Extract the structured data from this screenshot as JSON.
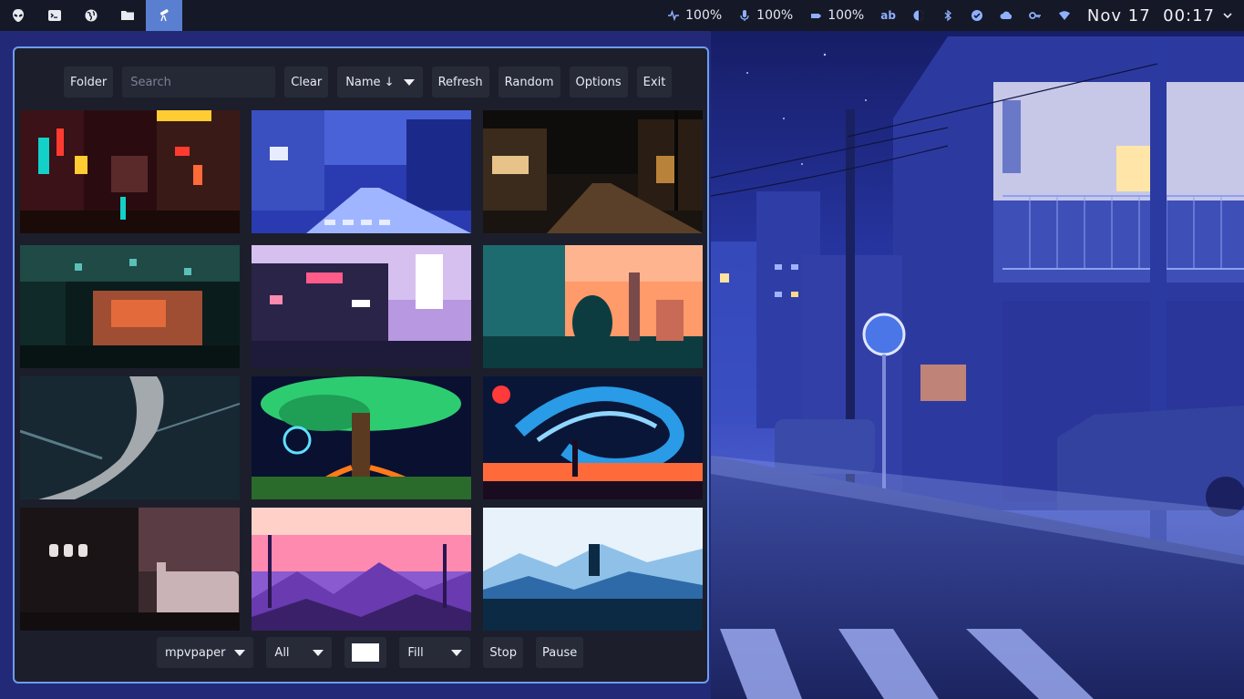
{
  "topbar": {
    "workspaces": [
      {
        "icon": "alien-icon",
        "active": false
      },
      {
        "icon": "terminal-icon",
        "active": false
      },
      {
        "icon": "globe-icon",
        "active": false
      },
      {
        "icon": "folder-icon",
        "active": false
      },
      {
        "icon": "telescope-icon",
        "active": true
      }
    ],
    "tray": {
      "cpu": "100%",
      "mic": "100%",
      "battery": "100%",
      "keyboard_layout": "ab",
      "date": "Nov 17",
      "time": "00:17"
    }
  },
  "app": {
    "toolbar": {
      "folder_label": "Folder",
      "search_placeholder": "Search",
      "clear_label": "Clear",
      "sort_label": "Name ↓",
      "refresh_label": "Refresh",
      "random_label": "Random",
      "options_label": "Options",
      "exit_label": "Exit"
    },
    "wallpapers": [
      {
        "id": "neon-alley",
        "palette": [
          "#2a0c10",
          "#ff3b30",
          "#ffcc33",
          "#13d1c8"
        ]
      },
      {
        "id": "blue-street",
        "palette": [
          "#1b2a8a",
          "#4a6ae0",
          "#9fb5ff",
          "#e8ecff"
        ]
      },
      {
        "id": "night-street",
        "palette": [
          "#0f0d0b",
          "#3a2b1c",
          "#b9823a",
          "#e7c38a"
        ]
      },
      {
        "id": "teal-interior",
        "palette": [
          "#0b1c1c",
          "#1f4a46",
          "#e36a3a",
          "#5ac0b8"
        ]
      },
      {
        "id": "pink-city",
        "palette": [
          "#1e1a3a",
          "#c9a3e6",
          "#ff5c8a",
          "#ffffff"
        ]
      },
      {
        "id": "sunset-silhouette",
        "palette": [
          "#0d3c40",
          "#1d6b6e",
          "#ff9a6a",
          "#ffc8a6"
        ]
      },
      {
        "id": "branch-closeup",
        "palette": [
          "#0c151c",
          "#1f3642",
          "#5b7b88",
          "#a3a9ad"
        ]
      },
      {
        "id": "neon-tree",
        "palette": [
          "#0a1030",
          "#2ecc71",
          "#ff7a1a",
          "#5de1ff"
        ]
      },
      {
        "id": "swirl-sky",
        "palette": [
          "#0a1638",
          "#2a9be6",
          "#ff3a3a",
          "#ffb06a"
        ]
      },
      {
        "id": "unic-shop",
        "palette": [
          "#1a1416",
          "#5a3d44",
          "#c9b3b6",
          "#e8e2e2"
        ]
      },
      {
        "id": "pink-mountains",
        "palette": [
          "#3a2068",
          "#8a5ad0",
          "#ff8ab0",
          "#ffd0c8"
        ]
      },
      {
        "id": "blue-forest",
        "palette": [
          "#0c2a44",
          "#2e6aa8",
          "#8fc0e8",
          "#e7f2fb"
        ]
      }
    ],
    "bottom": {
      "backend_label": "mpvpaper",
      "filter_label": "All",
      "color_value": "#ffffff",
      "fill_label": "Fill",
      "stop_label": "Stop",
      "pause_label": "Pause"
    }
  }
}
